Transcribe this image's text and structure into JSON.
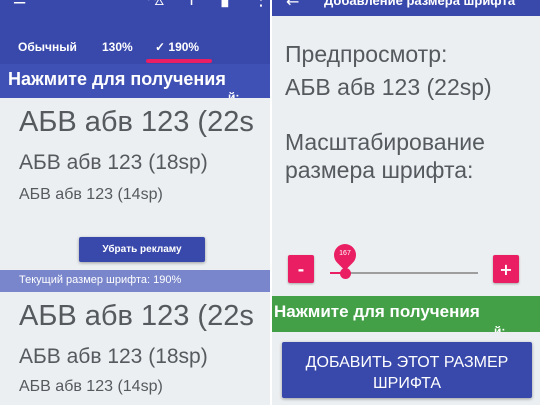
{
  "left": {
    "toolbar": {
      "icons": [
        "menu-icon",
        "cart-icon",
        "plus-icon",
        "bookmark-icon",
        "more-vert-icon"
      ],
      "menu_glyph": "≡",
      "cart_glyph": "⛍",
      "plus_glyph": "+",
      "bookmark_glyph": "▮",
      "more_glyph": "⋮"
    },
    "tabs": [
      {
        "label": "Обычный"
      },
      {
        "label": "130%"
      },
      {
        "label": "✓ 190%"
      }
    ],
    "active_tab": "✓ 190%",
    "ad_banner": {
      "text": "Нажмите для получения",
      "cutoff": "й:"
    },
    "previews_top": [
      "АБВ абв 123 (22s",
      "АБВ абв 123 (18sp)",
      "АБВ абв 123 (14sp)"
    ],
    "remove_ad_label": "Убрать рекламу",
    "current_size_text": "Текущий размер шрифта: 190%",
    "previews_bottom": [
      "АБВ абв 123 (22s",
      "АБВ абв 123 (18sp)",
      "АБВ абв 123 (14sp)"
    ]
  },
  "right": {
    "toolbar": {
      "back_glyph": "←",
      "title": "Добавление размера шрифта"
    },
    "preview_label": "Предпросмотр:",
    "preview_value": "АБВ абв 123 (22sp)",
    "scale_label_line1": "Масштабирование",
    "scale_label_line2": "размера шрифта:",
    "minus_label": "-",
    "plus_label": "+",
    "slider": {
      "value": "167",
      "fraction": 0.1
    },
    "ad_banner": {
      "text": "Нажмите для получения",
      "cutoff": "й:"
    },
    "add_button_line1": "ДОБАВИТЬ ЭТОТ РАЗМЕР",
    "add_button_line2": "ШРИФТА"
  },
  "colors": {
    "primary": "#3949ab",
    "accent": "#e91e63",
    "ad_green": "#43a047",
    "current_size_bar": "#7986cb",
    "preview_text": "#555a5f",
    "background": "#eceff1"
  }
}
